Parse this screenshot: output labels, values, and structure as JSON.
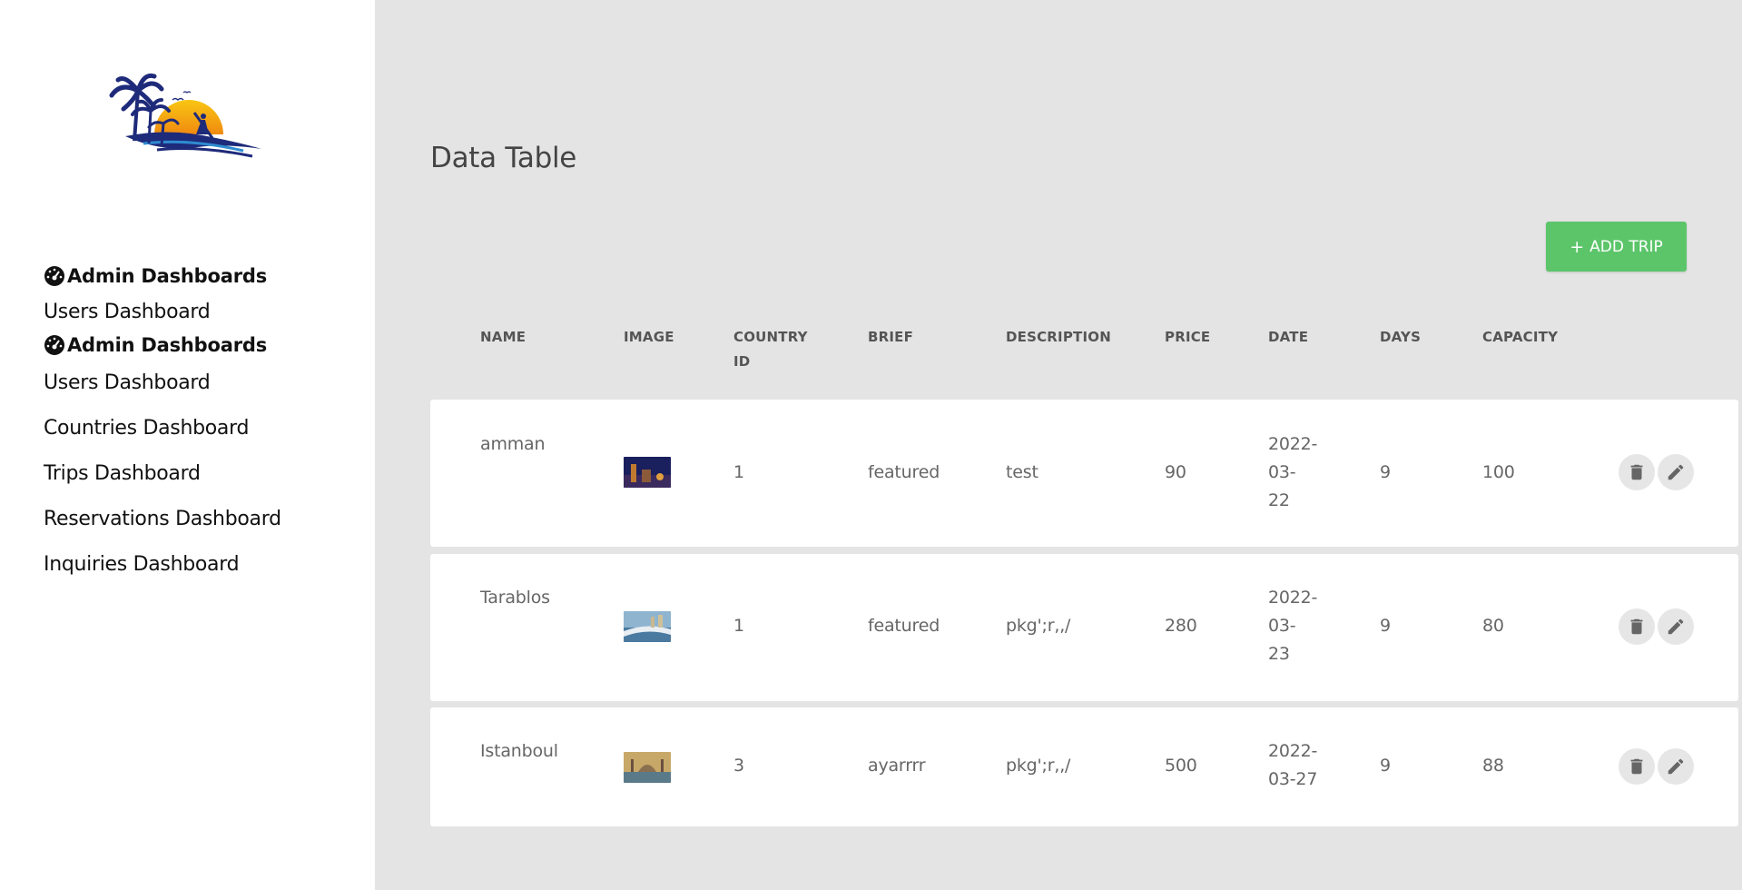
{
  "sidebar": {
    "nav": [
      {
        "type": "heading",
        "label": "Admin Dashboards"
      },
      {
        "type": "link",
        "label": "Users Dashboard"
      },
      {
        "type": "heading",
        "label": "Admin Dashboards"
      },
      {
        "type": "link",
        "label": "Users Dashboard"
      },
      {
        "type": "link",
        "label": "Countries Dashboard"
      },
      {
        "type": "link",
        "label": "Trips Dashboard"
      },
      {
        "type": "link",
        "label": "Reservations Dashboard"
      },
      {
        "type": "link",
        "label": "Inquiries Dashboard"
      }
    ]
  },
  "main": {
    "title": "Data Table",
    "add_button": {
      "plus": "+",
      "label": "ADD TRIP"
    },
    "columns": {
      "name": "NAME",
      "image": "IMAGE",
      "country_id_1": "COUNTRY",
      "country_id_2": "ID",
      "brief": "BRIEF",
      "description": "DESCRIPTION",
      "price": "PRICE",
      "date": "DATE",
      "days": "DAYS",
      "capacity": "CAPACITY"
    },
    "rows": [
      {
        "name": "amman",
        "country_id": "1",
        "brief": "featured",
        "description": "test",
        "price": "90",
        "date_lines": [
          "2022-",
          "03-",
          "22"
        ],
        "days": "9",
        "capacity": "100"
      },
      {
        "name": "Tarablos",
        "country_id": "1",
        "brief": "featured",
        "description": "pkg';r,,/",
        "price": "280",
        "date_lines": [
          "2022-",
          "03-",
          "23"
        ],
        "days": "9",
        "capacity": "80"
      },
      {
        "name": "Istanboul",
        "country_id": "3",
        "brief": "ayarrrr",
        "description": "pkg';r,,/",
        "price": "500",
        "date_lines": [
          "2022-",
          "03-27"
        ],
        "days": "9",
        "capacity": "88"
      }
    ]
  },
  "colors": {
    "accent_green": "#5cc56a",
    "background": "#e4e4e4",
    "sidebar": "#ffffff"
  }
}
